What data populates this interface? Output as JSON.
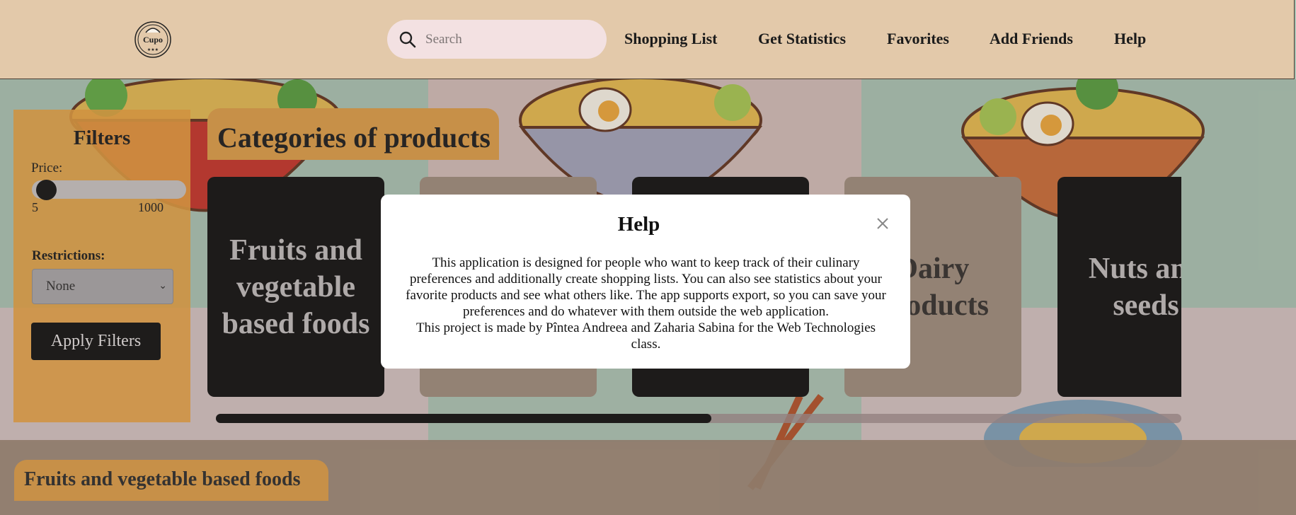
{
  "header": {
    "logo_text": "Cupo",
    "search": {
      "placeholder": "Search",
      "value": ""
    },
    "nav": [
      {
        "label": "Shopping List"
      },
      {
        "label": "Get Statistics"
      },
      {
        "label": "Favorites"
      },
      {
        "label": "Add Friends"
      },
      {
        "label": "Help"
      }
    ]
  },
  "filters": {
    "title": "Filters",
    "price_label": "Price:",
    "price_min": "5",
    "price_max": "1000",
    "price_value_fraction": 0.0,
    "restrictions_label": "Restrictions:",
    "restrictions_selected": "None",
    "apply_label": "Apply Filters"
  },
  "categories": {
    "title": "Categories of products",
    "cards": [
      {
        "label": "Fruits and vegetable based foods",
        "style": "dark"
      },
      {
        "label": "",
        "style": "light"
      },
      {
        "label": "",
        "style": "dark"
      },
      {
        "label": "Dairy products",
        "style": "light"
      },
      {
        "label": "Nuts and seeds",
        "style": "dark"
      }
    ],
    "scroll_fraction": 0.51
  },
  "section": {
    "title": "Fruits and vegetable based foods"
  },
  "modal": {
    "title": "Help",
    "body": "This application is designed for people who want to keep track of their culinary preferences and additionally create shopping lists. You can also see statistics about your favorite products and see what others like. The app supports export, so you can save your preferences and do whatever with them outside the web application.\nThis project is made by Pîntea Andreea and Zaharia Sabina for the Web Technologies class."
  },
  "colors": {
    "header_bg": "#e3c9aa",
    "accent_orange": "#de9a3f",
    "card_dark": "#040404",
    "card_light": "#9b8878",
    "search_bg": "#f3e1e2"
  }
}
